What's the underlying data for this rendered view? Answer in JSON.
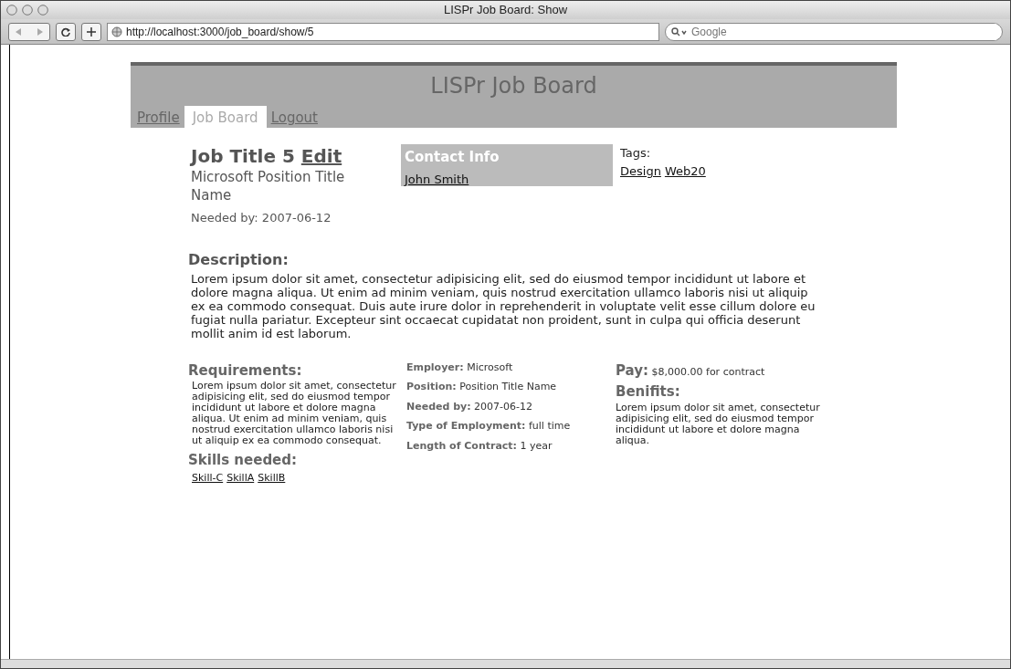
{
  "window": {
    "title": "LISPr Job Board: Show"
  },
  "toolbar": {
    "address": "http://localhost:3000/job_board/show/5",
    "search": {
      "placeholder": "Google"
    }
  },
  "site": {
    "title": "LISPr Job Board",
    "tabs": [
      {
        "label": "Profile",
        "selected": false
      },
      {
        "label": "Job Board",
        "selected": true
      },
      {
        "label": "Logout",
        "selected": false
      }
    ]
  },
  "job": {
    "title": "Job Title 5",
    "edit_link": "Edit",
    "subtitle": "Microsoft Position Title Name",
    "needed_by": "Needed by: 2007-06-12"
  },
  "contact": {
    "heading": "Contact Info",
    "name": "John Smith"
  },
  "tags": {
    "label": "Tags:",
    "items": [
      "Design",
      "Web20"
    ]
  },
  "description": {
    "heading": "Description:",
    "text": "Lorem ipsum dolor sit amet, consectetur adipisicing elit, sed do eiusmod tempor incididunt ut labore et dolore magna aliqua. Ut enim ad minim veniam, quis nostrud exercitation ullamco laboris nisi ut aliquip ex ea commodo consequat. Duis aute irure dolor in reprehenderit in voluptate velit esse cillum dolore eu fugiat nulla pariatur. Excepteur sint occaecat cupidatat non proident, sunt in culpa qui officia deserunt mollit anim id est laborum."
  },
  "requirements": {
    "heading": "Requirements:",
    "text": "Lorem ipsum dolor sit amet, consectetur adipisicing elit, sed do eiusmod tempor incididunt ut labore et dolore magna aliqua. Ut enim ad minim veniam, quis nostrud exercitation ullamco laboris nisi ut aliquip ex ea commodo consequat."
  },
  "skills": {
    "heading": "Skills needed:",
    "items": [
      "Skill-C",
      "SkillA",
      "SkillB"
    ]
  },
  "details": [
    {
      "label": "Employer:",
      "value": "Microsoft"
    },
    {
      "label": "Position:",
      "value": "Position Title Name"
    },
    {
      "label": "Needed by:",
      "value": "2007-06-12"
    },
    {
      "label": "Type of Employment:",
      "value": "full time"
    },
    {
      "label": "Length of Contract:",
      "value": "1 year"
    }
  ],
  "pay": {
    "label": "Pay:",
    "value": "$8,000.00 for contract"
  },
  "benefits": {
    "heading": "Benifits:",
    "text": "Lorem ipsum dolor sit amet, consectetur adipisicing elit, sed do eiusmod tempor incididunt ut labore et dolore magna aliqua."
  }
}
